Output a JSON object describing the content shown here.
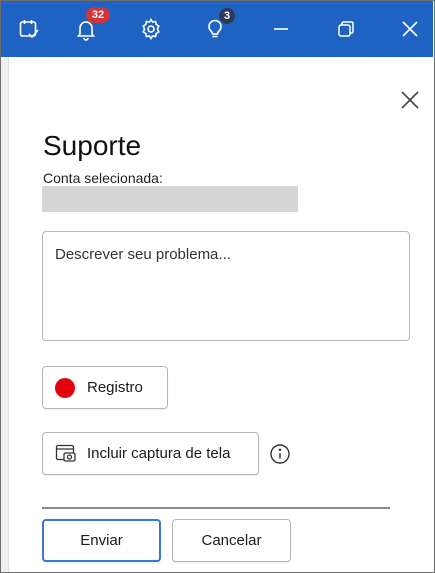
{
  "titlebar": {
    "bg_color": "#1f63c2",
    "notifications_count": "32",
    "tips_count": "3",
    "icons": [
      "tasks-check-icon",
      "bell-icon",
      "gear-icon",
      "lightbulb-icon",
      "minimize-icon",
      "restore-icon",
      "close-icon"
    ]
  },
  "panel": {
    "title": "Suporte",
    "account_label": "Conta selecionada:",
    "description_placeholder": "Descrever seu problema...",
    "record_label": "Registro",
    "screenshot_label": "Incluir captura de tela",
    "send_label": "Enviar",
    "cancel_label": "Cancelar",
    "record_color": "#e3000f",
    "send_border_color": "#3a78c9"
  }
}
